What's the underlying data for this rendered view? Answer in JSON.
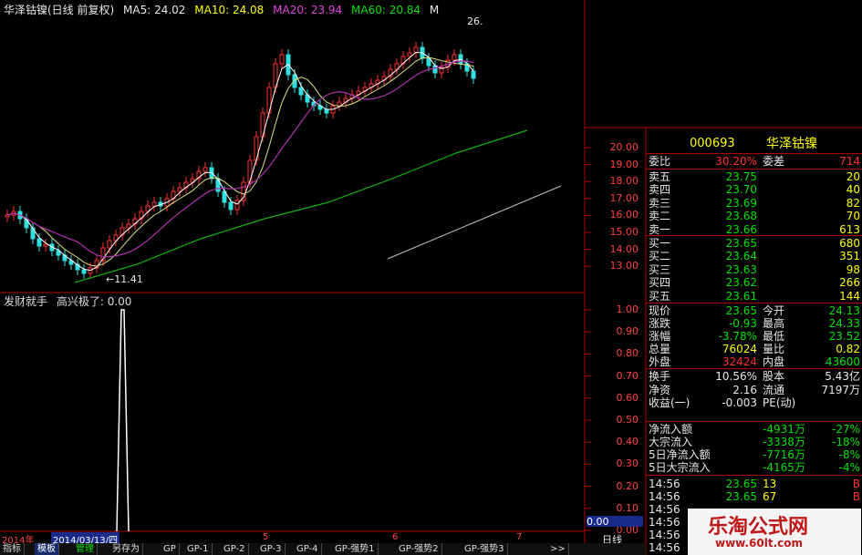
{
  "header": {
    "title": "华泽钴镍(日线 前复权)",
    "ma5_label": "MA5: 24.02",
    "ma10_label": "MA10: 24.08",
    "ma20_label": "MA20: 23.94",
    "ma60_label": "MA60: 20.84",
    "ma_more": "M"
  },
  "price_axis": [
    "20.00",
    "19.00",
    "18.00",
    "17.00",
    "16.00",
    "15.00",
    "14.00",
    "13.00"
  ],
  "annotations": {
    "low": "←11.41",
    "high": "26."
  },
  "indicator": {
    "name": "发财就手",
    "label": "高兴极了: 0.00",
    "axis": [
      "1.00",
      "0.90",
      "0.80",
      "0.70",
      "0.60",
      "0.50",
      "0.40",
      "0.30",
      "0.20",
      "0.10",
      "0.00"
    ],
    "value": "0.00"
  },
  "date_axis": {
    "year": "2014年",
    "selected": "2014/03/13/四",
    "months": [
      "5",
      "6",
      "7"
    ]
  },
  "quote": {
    "code": "000693",
    "name": "华泽钴镍",
    "ratio_label": "委比",
    "ratio": "30.20%",
    "diff_label": "委差",
    "diff": "714",
    "sells": [
      {
        "label": "卖五",
        "price": "23.75",
        "vol": "20"
      },
      {
        "label": "卖四",
        "price": "23.70",
        "vol": "40"
      },
      {
        "label": "卖三",
        "price": "23.69",
        "vol": "82"
      },
      {
        "label": "卖二",
        "price": "23.68",
        "vol": "70"
      },
      {
        "label": "卖一",
        "price": "23.66",
        "vol": "613"
      }
    ],
    "buys": [
      {
        "label": "买一",
        "price": "23.65",
        "vol": "680"
      },
      {
        "label": "买二",
        "price": "23.64",
        "vol": "351"
      },
      {
        "label": "买三",
        "price": "23.63",
        "vol": "98"
      },
      {
        "label": "买四",
        "price": "23.62",
        "vol": "266"
      },
      {
        "label": "买五",
        "price": "23.61",
        "vol": "144"
      }
    ],
    "stats": [
      {
        "l1": "现价",
        "v1": "23.65",
        "l2": "今开",
        "v2": "24.13",
        "c1": "green",
        "c2": "green"
      },
      {
        "l1": "涨跌",
        "v1": "-0.93",
        "l2": "最高",
        "v2": "24.33",
        "c1": "green",
        "c2": "green"
      },
      {
        "l1": "涨幅",
        "v1": "-3.78%",
        "l2": "最低",
        "v2": "23.52",
        "c1": "green",
        "c2": "green"
      },
      {
        "l1": "总量",
        "v1": "76024",
        "l2": "量比",
        "v2": "0.82",
        "c1": "yellow",
        "c2": "yellow"
      },
      {
        "l1": "外盘",
        "v1": "32424",
        "l2": "内盘",
        "v2": "43600",
        "c1": "red",
        "c2": "green"
      }
    ],
    "finance": [
      {
        "l1": "换手",
        "v1": "10.56%",
        "l2": "股本",
        "v2": "5.43亿"
      },
      {
        "l1": "净资",
        "v1": "2.16",
        "l2": "流通",
        "v2": "7197万"
      },
      {
        "l1": "收益(一)",
        "v1": "-0.003",
        "l2": "PE(动)",
        "v2": ""
      }
    ],
    "flows": [
      {
        "label": "净流入额",
        "value": "-4931万",
        "pct": "-27%"
      },
      {
        "label": "大宗流入",
        "value": "-3338万",
        "pct": "-18%"
      },
      {
        "label": "5日净流入额",
        "value": "-7716万",
        "pct": "-8%"
      },
      {
        "label": "5日大宗流入",
        "value": "-4165万",
        "pct": "-4%"
      }
    ],
    "ticks": [
      {
        "time": "14:56",
        "price": "23.65",
        "vol": "13",
        "flag": "B"
      },
      {
        "time": "14:56",
        "price": "23.65",
        "vol": "67",
        "flag": "B"
      },
      {
        "time": "14:56",
        "price": "",
        "vol": "",
        "flag": ""
      },
      {
        "time": "14:56",
        "price": "",
        "vol": "",
        "flag": ""
      },
      {
        "time": "14:56",
        "price": "",
        "vol": "",
        "flag": ""
      },
      {
        "time": "14:56",
        "price": "",
        "vol": "",
        "flag": ""
      }
    ],
    "period": "日线"
  },
  "tabs": [
    "指标",
    "模板",
    "管理",
    "另存为",
    "GP",
    "GP-1",
    "GP-2",
    "GP-3",
    "GP-4",
    "GP-强势1",
    "GP-强势2",
    "GP-强势3",
    ">>"
  ],
  "watermark": {
    "title": "乐淘公式网",
    "url": "www.60lt.com"
  },
  "colors": {
    "up": "#ff3030",
    "down": "#00e0e0",
    "ma5": "#ffffff",
    "ma10": "#e0e080",
    "ma20": "#c030c0",
    "ma60": "#10c010"
  }
}
